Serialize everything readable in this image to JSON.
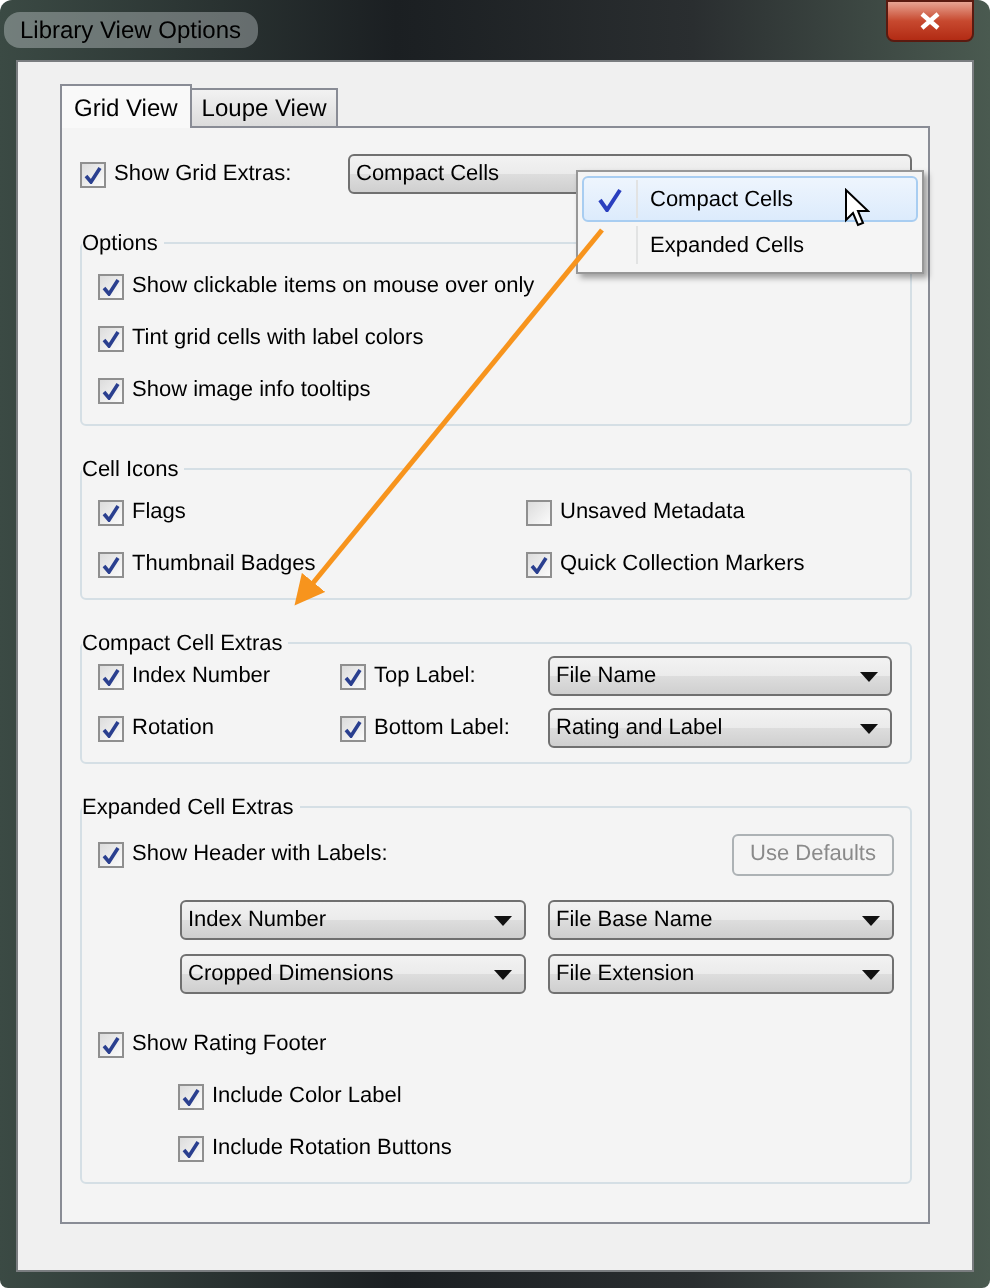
{
  "window": {
    "title": "Library View Options"
  },
  "tabs": [
    {
      "label": "Grid View",
      "selected": true
    },
    {
      "label": "Loupe View",
      "selected": false
    }
  ],
  "grid_extras": {
    "label": "Show Grid Extras:",
    "checked": true,
    "value": "Compact Cells",
    "menu": [
      {
        "label": "Compact Cells",
        "selected": true
      },
      {
        "label": "Expanded Cells",
        "selected": false
      }
    ]
  },
  "options": {
    "title": "Options",
    "items": [
      {
        "label": "Show clickable items on mouse over only",
        "checked": true
      },
      {
        "label": "Tint grid cells with label colors",
        "checked": true
      },
      {
        "label": "Show image info tooltips",
        "checked": true
      }
    ]
  },
  "cell_icons": {
    "title": "Cell Icons",
    "items": [
      {
        "label": "Flags",
        "checked": true
      },
      {
        "label": "Unsaved Metadata",
        "checked": false
      },
      {
        "label": "Thumbnail Badges",
        "checked": true
      },
      {
        "label": "Quick Collection Markers",
        "checked": true
      }
    ]
  },
  "compact_cell_extras": {
    "title": "Compact Cell Extras",
    "rows": [
      {
        "item": {
          "label": "Index Number",
          "checked": true
        },
        "label_option": {
          "label": "Top Label:",
          "checked": true
        },
        "value": "File Name"
      },
      {
        "item": {
          "label": "Rotation",
          "checked": true
        },
        "label_option": {
          "label": "Bottom Label:",
          "checked": true
        },
        "value": "Rating and Label"
      }
    ]
  },
  "expanded_cell_extras": {
    "title": "Expanded Cell Extras",
    "header": {
      "label": "Show Header with Labels:",
      "checked": true
    },
    "use_defaults": {
      "label": "Use Defaults",
      "disabled": true
    },
    "header_fields": [
      "Index Number",
      "File Base Name",
      "Cropped Dimensions",
      "File Extension"
    ],
    "rating_footer": {
      "label": "Show Rating Footer",
      "checked": true,
      "children": [
        {
          "label": "Include Color Label",
          "checked": true
        },
        {
          "label": "Include Rotation Buttons",
          "checked": true
        }
      ]
    }
  }
}
